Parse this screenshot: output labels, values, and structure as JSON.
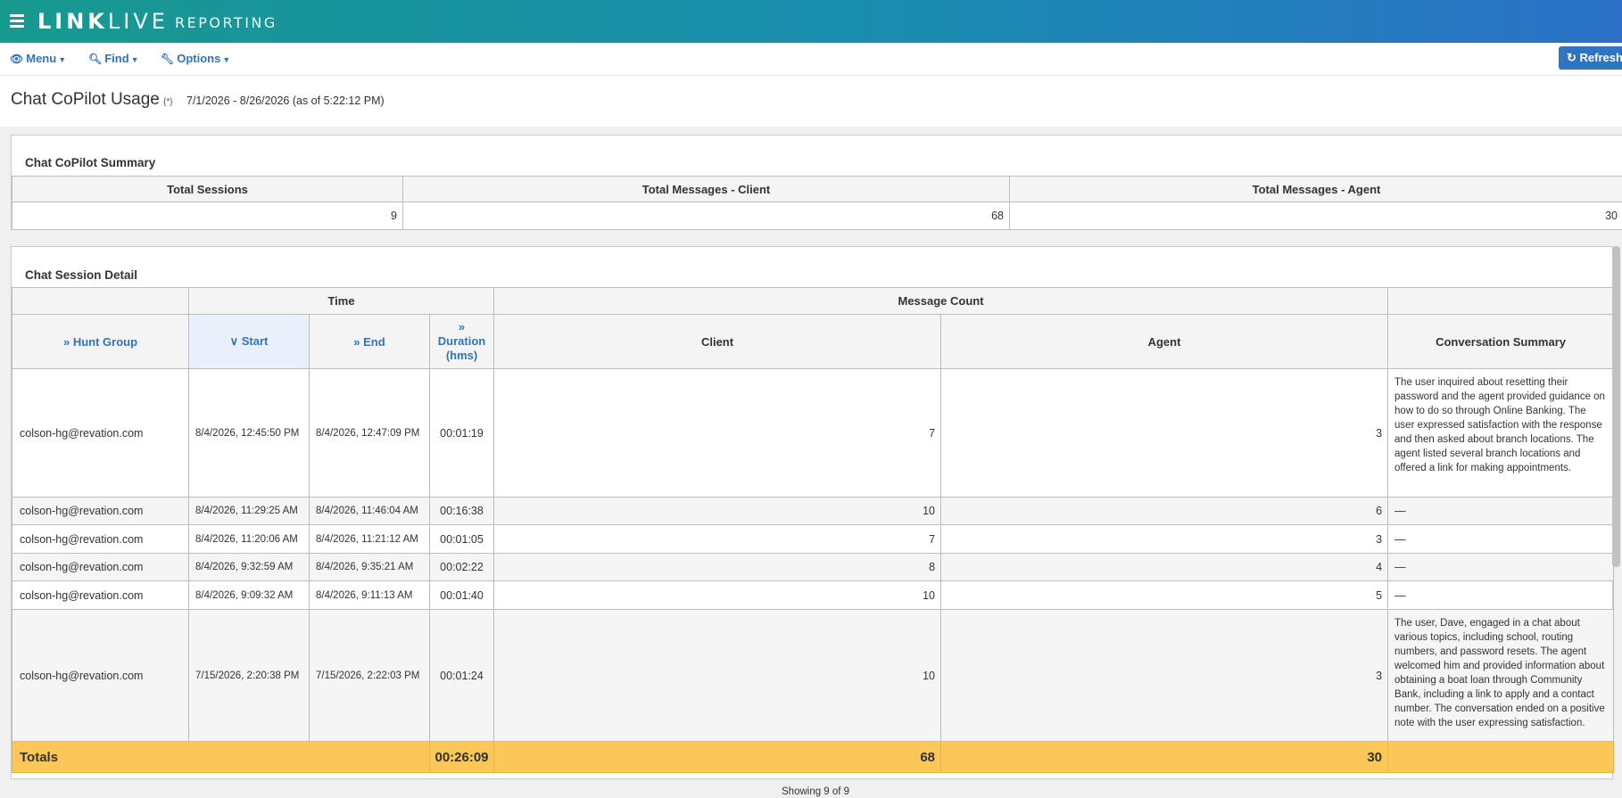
{
  "app": {
    "brand_link": "LINK",
    "brand_live": "LIVE",
    "brand_sub": "REPORTING"
  },
  "toolbar": {
    "menu": "Menu",
    "find": "Find",
    "options": "Options",
    "refresh": "Refresh"
  },
  "report": {
    "title": "Chat CoPilot Usage",
    "params_marker": "{*}",
    "date_range": "7/1/2026 - 8/26/2026 (as of 5:22:12 PM)"
  },
  "summary": {
    "title": "Chat CoPilot Summary",
    "headers": [
      "Total Sessions",
      "Total Messages - Client",
      "Total Messages - Agent"
    ],
    "values": [
      "9",
      "68",
      "30"
    ]
  },
  "detail": {
    "title": "Chat Session Detail",
    "group_headers": {
      "time": "Time",
      "message_count": "Message Count"
    },
    "columns": {
      "hunt_group": "Hunt Group",
      "start": "Start",
      "end": "End",
      "duration": "Duration (hms)",
      "client": "Client",
      "agent": "Agent",
      "summary": "Conversation Summary"
    },
    "rows": [
      {
        "hunt_group": "colson-hg@revation.com",
        "start": "8/4/2026, 12:45:50 PM",
        "end": "8/4/2026, 12:47:09 PM",
        "duration": "00:01:19",
        "client": "7",
        "agent": "3",
        "summary": "The user inquired about resetting their password and the agent provided guidance on how to do so through Online Banking. The user expressed satisfaction with the response and then asked about branch locations. The agent listed several branch locations and offered a link for making appointments."
      },
      {
        "hunt_group": "colson-hg@revation.com",
        "start": "8/4/2026, 11:29:25 AM",
        "end": "8/4/2026, 11:46:04 AM",
        "duration": "00:16:38",
        "client": "10",
        "agent": "6",
        "summary": "—"
      },
      {
        "hunt_group": "colson-hg@revation.com",
        "start": "8/4/2026, 11:20:06 AM",
        "end": "8/4/2026, 11:21:12 AM",
        "duration": "00:01:05",
        "client": "7",
        "agent": "3",
        "summary": "—"
      },
      {
        "hunt_group": "colson-hg@revation.com",
        "start": "8/4/2026, 9:32:59 AM",
        "end": "8/4/2026, 9:35:21 AM",
        "duration": "00:02:22",
        "client": "8",
        "agent": "4",
        "summary": "—"
      },
      {
        "hunt_group": "colson-hg@revation.com",
        "start": "8/4/2026, 9:09:32 AM",
        "end": "8/4/2026, 9:11:13 AM",
        "duration": "00:01:40",
        "client": "10",
        "agent": "5",
        "summary": "—"
      },
      {
        "hunt_group": "colson-hg@revation.com",
        "start": "7/15/2026, 2:20:38 PM",
        "end": "7/15/2026, 2:22:03 PM",
        "duration": "00:01:24",
        "client": "10",
        "agent": "3",
        "summary": "The user, Dave, engaged in a chat about various topics, including school, routing numbers, and password resets. The agent welcomed him and provided information about obtaining a boat loan through Community Bank, including a link to apply and a contact number. The conversation ended on a positive note with the user expressing satisfaction."
      }
    ],
    "totals": {
      "label": "Totals",
      "duration": "00:26:09",
      "client": "68",
      "agent": "30"
    },
    "showing": "Showing 9 of 9"
  }
}
